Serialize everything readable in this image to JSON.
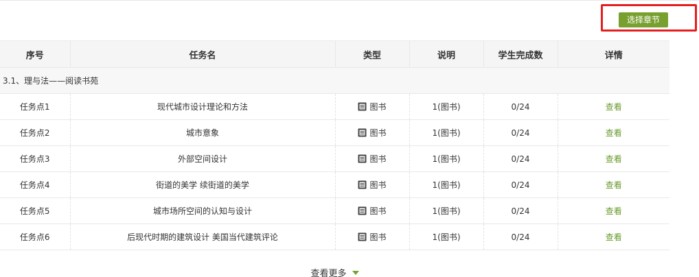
{
  "toolbar": {
    "select_chapter_label": "选择章节"
  },
  "table": {
    "columns": [
      "序号",
      "任务名",
      "类型",
      "说明",
      "学生完成数",
      "详情"
    ],
    "section_title": "3.1、理与法——阅读书苑",
    "rows": [
      {
        "index": "任务点1",
        "name": "现代城市设计理论和方法",
        "type": "图书",
        "note": "1(图书)",
        "completed": "0/24",
        "detail": "查看"
      },
      {
        "index": "任务点2",
        "name": "城市意象",
        "type": "图书",
        "note": "1(图书)",
        "completed": "0/24",
        "detail": "查看"
      },
      {
        "index": "任务点3",
        "name": "外部空间设计",
        "type": "图书",
        "note": "1(图书)",
        "completed": "0/24",
        "detail": "查看"
      },
      {
        "index": "任务点4",
        "name": "街道的美学 续街道的美学",
        "type": "图书",
        "note": "1(图书)",
        "completed": "0/24",
        "detail": "查看"
      },
      {
        "index": "任务点5",
        "name": "城市场所空间的认知与设计",
        "type": "图书",
        "note": "1(图书)",
        "completed": "0/24",
        "detail": "查看"
      },
      {
        "index": "任务点6",
        "name": "后现代时期的建筑设计 美国当代建筑评论",
        "type": "图书",
        "note": "1(图书)",
        "completed": "0/24",
        "detail": "查看"
      }
    ]
  },
  "footer": {
    "more_label": "查看更多"
  },
  "icons": {
    "type_icon": "book-icon",
    "more_icon": "caret-down-icon"
  },
  "colors": {
    "accent": "#78a02f",
    "link": "#6a9a2c",
    "highlight": "#e41e1e",
    "header_bg": "#f5f5f5"
  }
}
